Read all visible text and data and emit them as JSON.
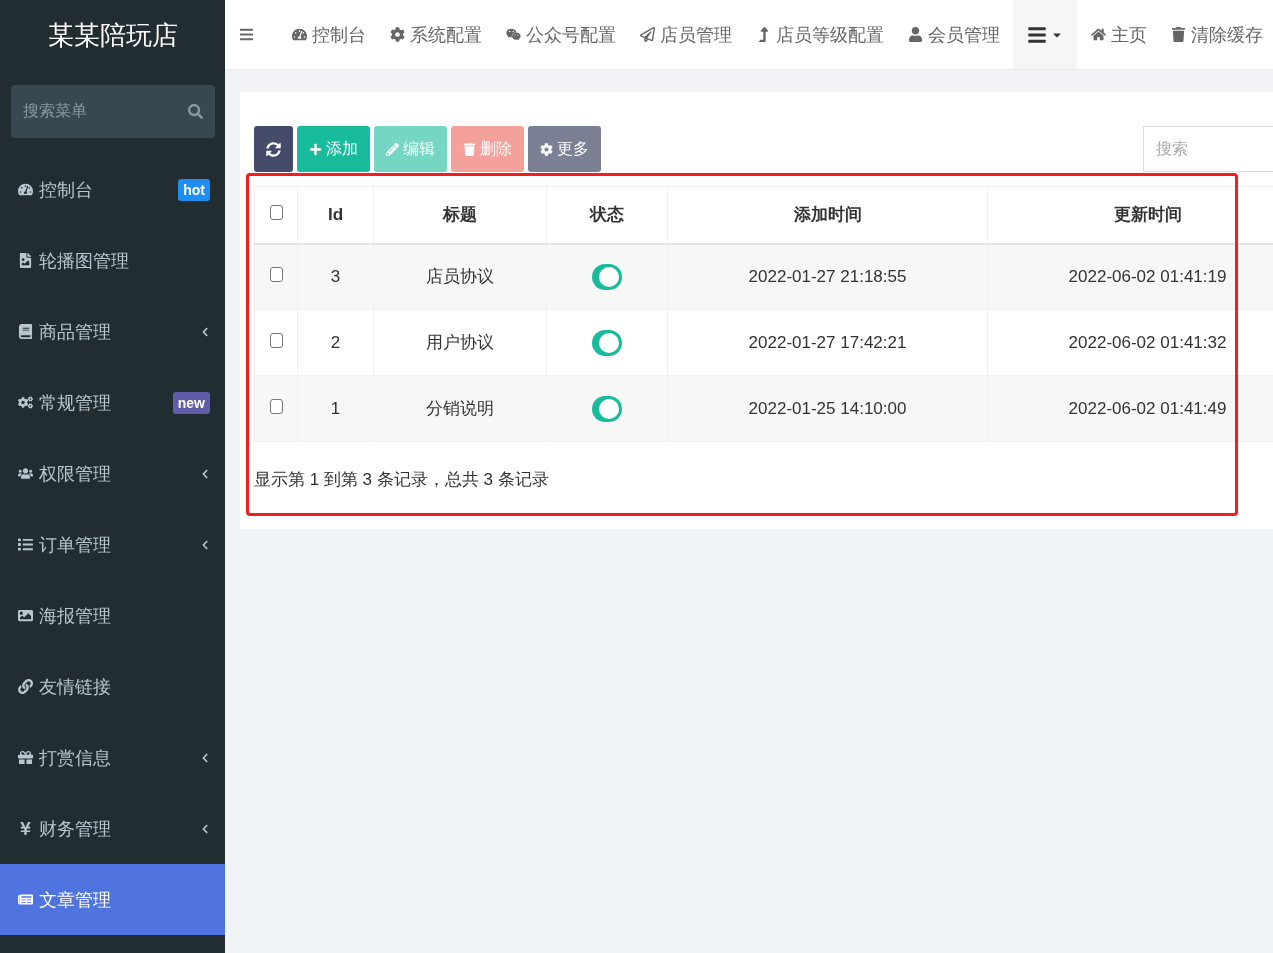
{
  "brand": "某某陪玩店",
  "sidebar": {
    "search": {
      "placeholder": "搜索菜单"
    },
    "items": [
      {
        "label": "控制台",
        "selected": false,
        "expandable": false,
        "badge": {
          "text": "hot",
          "color": "#1e8ef0"
        }
      },
      {
        "label": "轮播图管理",
        "selected": false,
        "expandable": false
      },
      {
        "label": "商品管理",
        "selected": false,
        "expandable": true
      },
      {
        "label": "常规管理",
        "selected": false,
        "expandable": false,
        "badge": {
          "text": "new",
          "color": "#605ca8"
        }
      },
      {
        "label": "权限管理",
        "selected": false,
        "expandable": true
      },
      {
        "label": "订单管理",
        "selected": false,
        "expandable": true
      },
      {
        "label": "海报管理",
        "selected": false,
        "expandable": false
      },
      {
        "label": "友情链接",
        "selected": false,
        "expandable": false
      },
      {
        "label": "打赏信息",
        "selected": false,
        "expandable": true
      },
      {
        "label": "财务管理",
        "selected": false,
        "expandable": true
      },
      {
        "label": "文章管理",
        "selected": true,
        "expandable": false
      }
    ]
  },
  "topnav": {
    "items": [
      {
        "label": "控制台"
      },
      {
        "label": "系统配置"
      },
      {
        "label": "公众号配置"
      },
      {
        "label": "店员管理"
      },
      {
        "label": "店员等级配置"
      },
      {
        "label": "会员管理"
      }
    ],
    "right": [
      {
        "label": "主页"
      },
      {
        "label": "清除缓存"
      }
    ]
  },
  "toolbar": {
    "buttons": [
      {
        "kind": "refresh",
        "disabled": false
      },
      {
        "kind": "add",
        "label": "添加",
        "disabled": false
      },
      {
        "kind": "edit",
        "label": "编辑",
        "disabled": true
      },
      {
        "kind": "delete",
        "label": "删除",
        "disabled": true
      },
      {
        "kind": "more",
        "label": "更多",
        "disabled": false
      }
    ],
    "search": {
      "placeholder": "搜索"
    }
  },
  "table": {
    "all_checked": false,
    "columns": [
      "Id",
      "标题",
      "状态",
      "添加时间",
      "更新时间"
    ],
    "rows": [
      {
        "checked": false,
        "id": "3",
        "title": "店员协议",
        "status_on": true,
        "created": "2022-01-27 21:18:55",
        "updated": "2022-06-02 01:41:19"
      },
      {
        "checked": false,
        "id": "2",
        "title": "用户协议",
        "status_on": true,
        "created": "2022-01-27 17:42:21",
        "updated": "2022-06-02 01:41:32"
      },
      {
        "checked": false,
        "id": "1",
        "title": "分销说明",
        "status_on": true,
        "created": "2022-01-25 14:10:00",
        "updated": "2022-06-02 01:41:49"
      }
    ]
  },
  "pagination_info": "显示第 1 到第 3 条记录，总共 3 条记录"
}
